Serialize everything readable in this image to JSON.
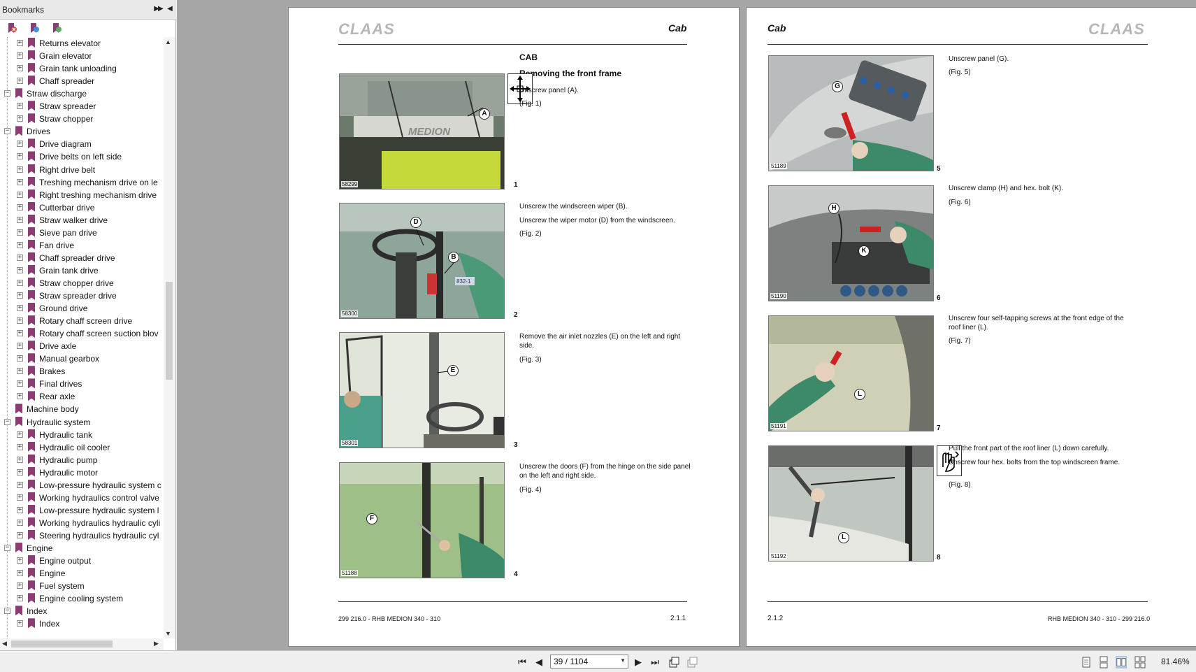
{
  "sidebar": {
    "title": "Bookmarks",
    "items": [
      {
        "label": "Returns elevator",
        "level": 2,
        "expander": "+"
      },
      {
        "label": "Grain elevator",
        "level": 2,
        "expander": "+"
      },
      {
        "label": "Grain tank unloading",
        "level": 2,
        "expander": "+"
      },
      {
        "label": "Chaff spreader",
        "level": 2,
        "expander": "+"
      },
      {
        "label": "Straw discharge",
        "level": 1,
        "expander": "−"
      },
      {
        "label": "Straw spreader",
        "level": 2,
        "expander": "+"
      },
      {
        "label": "Straw chopper",
        "level": 2,
        "expander": "+"
      },
      {
        "label": "Drives",
        "level": 1,
        "expander": "−"
      },
      {
        "label": "Drive diagram",
        "level": 2,
        "expander": "+"
      },
      {
        "label": "Drive belts on left side",
        "level": 2,
        "expander": "+"
      },
      {
        "label": "Right drive belt",
        "level": 2,
        "expander": "+"
      },
      {
        "label": "Treshing mechanism drive on le",
        "level": 2,
        "expander": "+"
      },
      {
        "label": "Right treshing mechanism drive",
        "level": 2,
        "expander": "+"
      },
      {
        "label": "Cutterbar drive",
        "level": 2,
        "expander": "+"
      },
      {
        "label": "Straw walker drive",
        "level": 2,
        "expander": "+"
      },
      {
        "label": "Sieve pan drive",
        "level": 2,
        "expander": "+"
      },
      {
        "label": "Fan drive",
        "level": 2,
        "expander": "+"
      },
      {
        "label": "Chaff spreader drive",
        "level": 2,
        "expander": "+"
      },
      {
        "label": "Grain tank drive",
        "level": 2,
        "expander": "+"
      },
      {
        "label": "Straw chopper drive",
        "level": 2,
        "expander": "+"
      },
      {
        "label": "Straw spreader drive",
        "level": 2,
        "expander": "+"
      },
      {
        "label": "Ground drive",
        "level": 2,
        "expander": "+"
      },
      {
        "label": "Rotary chaff screen drive",
        "level": 2,
        "expander": "+"
      },
      {
        "label": "Rotary chaff screen suction blov",
        "level": 2,
        "expander": "+"
      },
      {
        "label": "Drive axle",
        "level": 2,
        "expander": "+"
      },
      {
        "label": "Manual gearbox",
        "level": 2,
        "expander": "+"
      },
      {
        "label": "Brakes",
        "level": 2,
        "expander": "+"
      },
      {
        "label": "Final drives",
        "level": 2,
        "expander": "+"
      },
      {
        "label": "Rear axle",
        "level": 2,
        "expander": "+"
      },
      {
        "label": "Machine body",
        "level": 1,
        "expander": ""
      },
      {
        "label": "Hydraulic system",
        "level": 1,
        "expander": "−"
      },
      {
        "label": "Hydraulic tank",
        "level": 2,
        "expander": "+"
      },
      {
        "label": "Hydraulic oil cooler",
        "level": 2,
        "expander": "+"
      },
      {
        "label": "Hydraulic pump",
        "level": 2,
        "expander": "+"
      },
      {
        "label": "Hydraulic motor",
        "level": 2,
        "expander": "+"
      },
      {
        "label": "Low-pressure hydraulic system c",
        "level": 2,
        "expander": "+"
      },
      {
        "label": "Working hydraulics control valve",
        "level": 2,
        "expander": "+"
      },
      {
        "label": "Low-pressure hydraulic system l",
        "level": 2,
        "expander": "+"
      },
      {
        "label": "Working hydraulics hydraulic cyli",
        "level": 2,
        "expander": "+"
      },
      {
        "label": "Steering hydraulics hydraulic cyl",
        "level": 2,
        "expander": "+"
      },
      {
        "label": "Engine",
        "level": 1,
        "expander": "−"
      },
      {
        "label": "Engine output",
        "level": 2,
        "expander": "+"
      },
      {
        "label": "Engine",
        "level": 2,
        "expander": "+"
      },
      {
        "label": "Fuel system",
        "level": 2,
        "expander": "+"
      },
      {
        "label": "Engine cooling system",
        "level": 2,
        "expander": "+"
      },
      {
        "label": "Index",
        "level": 1,
        "expander": "−"
      },
      {
        "label": "Index",
        "level": 2,
        "expander": "+"
      }
    ]
  },
  "left_page": {
    "brand": "CLAAS",
    "section": "Cab",
    "heading": "CAB",
    "subheading": "Removing the front frame",
    "figures": [
      {
        "code": "58299",
        "num": "1",
        "callouts": [
          "A"
        ],
        "text": [
          "Unscrew panel (A).",
          "(Fig. 1)"
        ]
      },
      {
        "code": "58300",
        "num": "2",
        "callouts": [
          "D",
          "B"
        ],
        "text": [
          "Unscrew the windscreen wiper (B).",
          "Unscrew the wiper motor (D) from the windscreen.",
          "(Fig. 2)"
        ]
      },
      {
        "code": "58301",
        "num": "3",
        "callouts": [
          "E"
        ],
        "text": [
          "Remove the air inlet nozzles (E) on the left and right side.",
          "(Fig. 3)"
        ]
      },
      {
        "code": "51188",
        "num": "4",
        "callouts": [
          "F"
        ],
        "text": [
          "Unscrew the doors (F) from the hinge on the side panel on the left and right side.",
          "(Fig. 4)"
        ]
      }
    ],
    "footer_left": "299 216.0 - RHB MEDION 340 - 310",
    "footer_right": "2.1.1"
  },
  "right_page": {
    "brand": "CLAAS",
    "section": "Cab",
    "figures": [
      {
        "code": "51189",
        "num": "5",
        "callouts": [
          "G"
        ],
        "text": [
          "Unscrew panel (G).",
          "(Fig. 5)"
        ]
      },
      {
        "code": "51190",
        "num": "6",
        "callouts": [
          "H",
          "K"
        ],
        "text": [
          "Unscrew clamp (H) and hex. bolt (K).",
          "(Fig. 6)"
        ]
      },
      {
        "code": "51191",
        "num": "7",
        "callouts": [
          "L"
        ],
        "text": [
          "Unscrew four self-tapping screws at the front edge of the roof liner (L).",
          "(Fig. 7)"
        ]
      },
      {
        "code": "51192",
        "num": "8",
        "callouts": [
          "L"
        ],
        "text": [
          "Pull the front part of the roof liner (L) down carefully.",
          "Unscrew four hex. bolts from the top windscreen frame.",
          "(Fig. 8)"
        ]
      }
    ],
    "footer_left": "2.1.2",
    "footer_right": "RHB MEDION 340 - 310 - 299 216.0"
  },
  "figure_overlay_text": {
    "medion_label": "MEDION",
    "wiper_tag": "832-1"
  },
  "bottom_bar": {
    "page_indicator": "39 / 1104",
    "zoom": "81.46%"
  },
  "colors": {
    "bookmark": "#8d3b73",
    "page_bg": "#ffffff",
    "doc_bg": "#a6a6a6",
    "brand_gray": "#b6b6b6"
  }
}
